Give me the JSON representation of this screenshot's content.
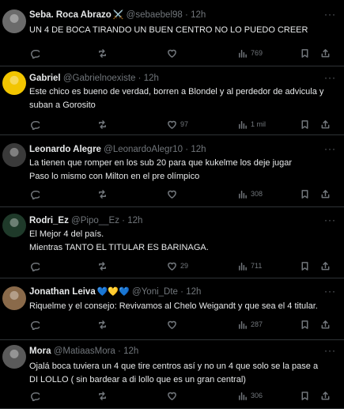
{
  "tweets": [
    {
      "name": "Seba. Roca Abrazo",
      "name_emoji": "⚔️",
      "handle": "@sebaebel98",
      "time": "12h",
      "lines": [
        "UN 4 DE BOCA TIRANDO UN BUEN CENTRO NO LO PUEDO CREER"
      ],
      "likes": "",
      "views": "769",
      "avatar_color": "#6b6b6b"
    },
    {
      "name": "Gabriel",
      "name_emoji": "",
      "handle": "@Gabrielnoexiste",
      "time": "12h",
      "lines": [
        "Este chico es bueno de verdad, borren a Blondel y al perdedor de advicula y",
        "suban a Gorosito"
      ],
      "likes": "97",
      "views": "1 mil",
      "avatar_color": "#f2c500"
    },
    {
      "name": "Leonardo Alegre",
      "name_emoji": "",
      "handle": "@LeonardoAlegr10",
      "time": "12h",
      "lines": [
        "La tienen que romper en los sub 20 para que kukelme los deje jugar",
        "Paso lo mismo con Milton en el pre olímpico"
      ],
      "likes": "",
      "views": "308",
      "avatar_color": "#3a3a3a"
    },
    {
      "name": "Rodri_Ez",
      "name_emoji": "",
      "handle": "@Pipo__Ez",
      "time": "12h",
      "lines": [
        "El Mejor 4 del país.",
        "Mientras TANTO EL TITULAR ES BARINAGA."
      ],
      "likes": "29",
      "views": "711",
      "avatar_color": "#1f3a2a"
    },
    {
      "name": "Jonathan Leiva",
      "name_emoji": "💙💛💙",
      "handle": "@Yoni_Dte",
      "time": "12h",
      "lines": [
        "Riquelme y el consejo: Revivamos al Chelo Weigandt y que sea el 4 titular."
      ],
      "likes": "",
      "views": "287",
      "avatar_color": "#8a6a4a"
    },
    {
      "name": "Mora",
      "name_emoji": "",
      "handle": "@MatiaasMora",
      "time": "12h",
      "lines": [
        "Ojalá boca tuviera un 4 que tire centros así y no un 4 que solo se la pase a",
        "DI LOLLO ( sin bardear a di lollo que es un gran central)"
      ],
      "likes": "",
      "views": "306",
      "avatar_color": "#5a5a5a"
    }
  ],
  "more_label": "···",
  "dot": "·"
}
